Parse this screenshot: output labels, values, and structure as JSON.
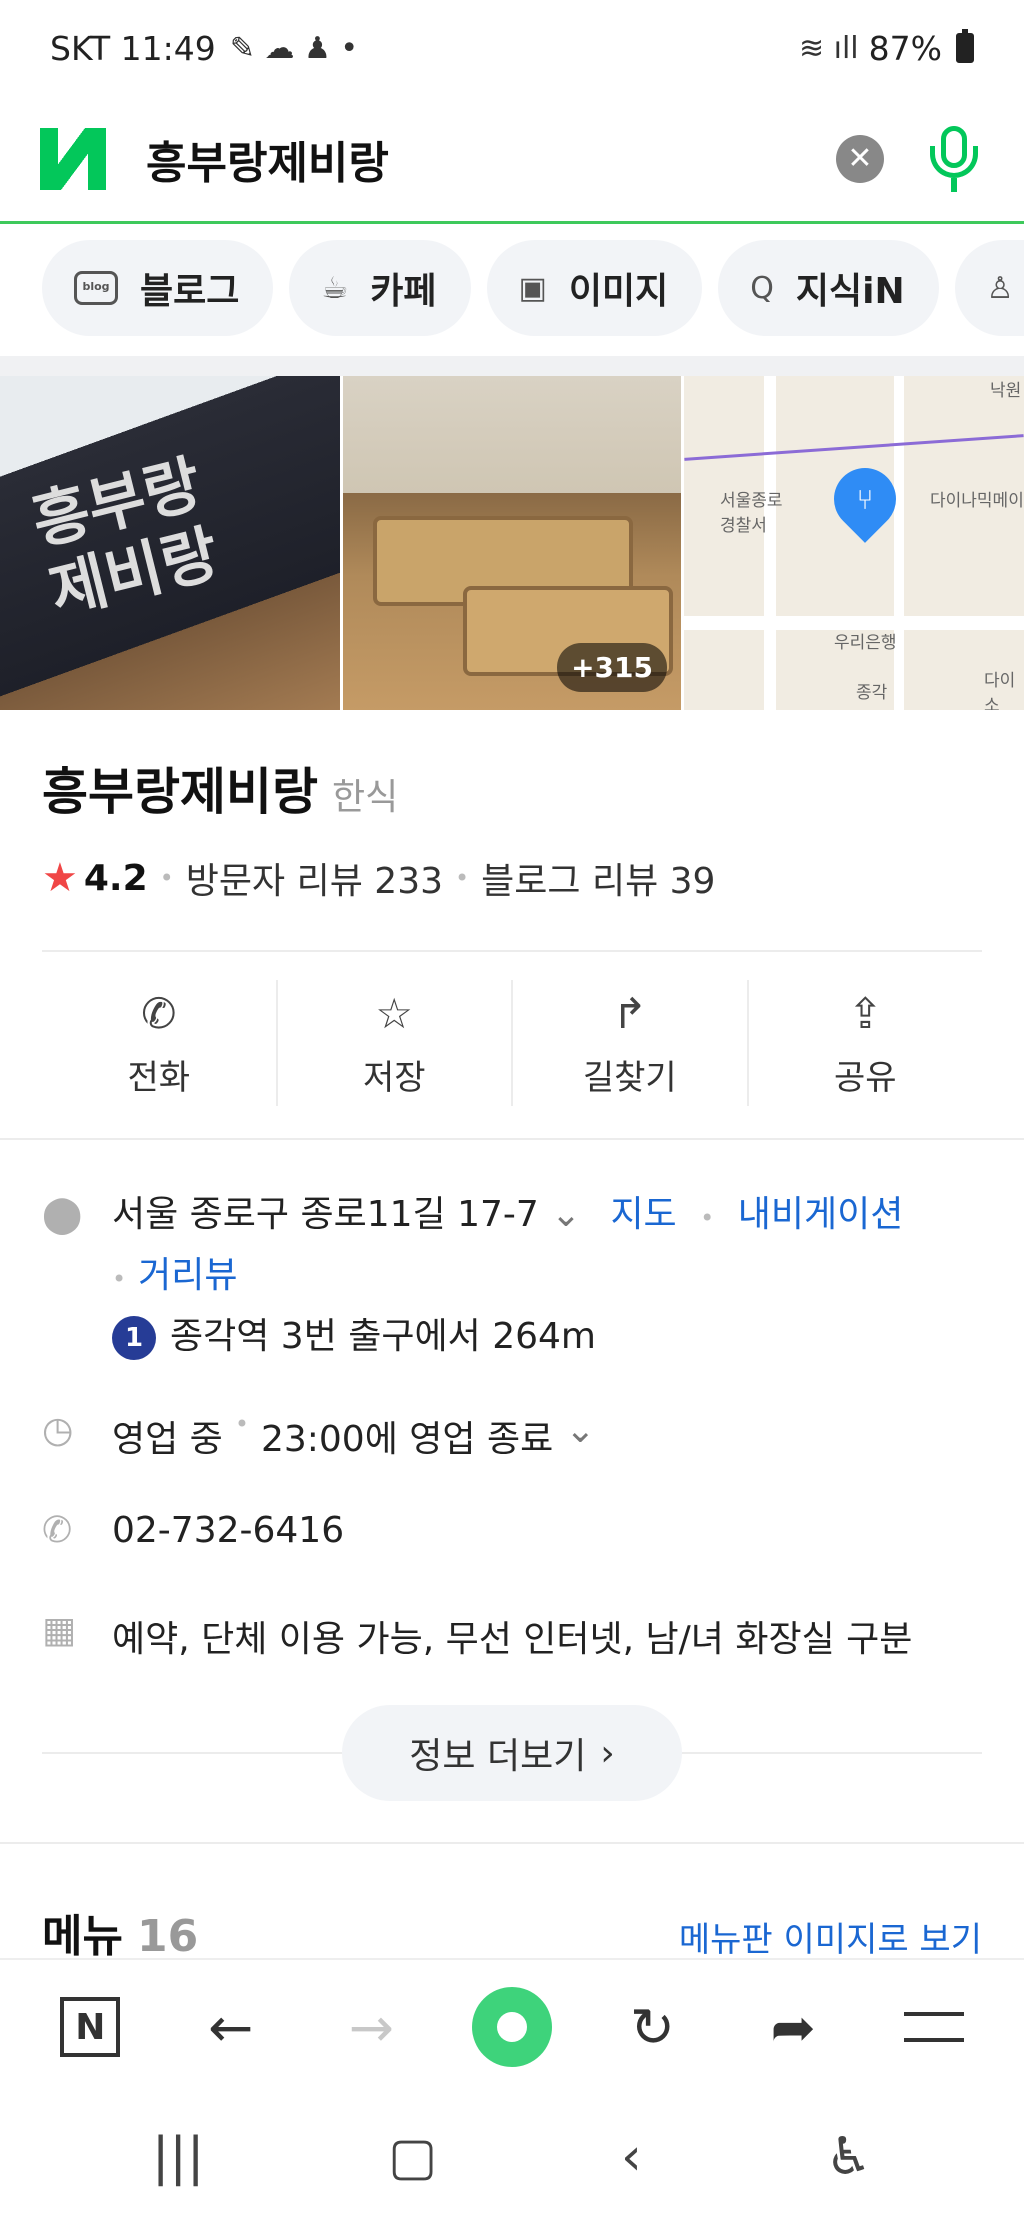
{
  "status_bar": {
    "carrier_time": "SKT 11:49",
    "battery": "87%"
  },
  "search": {
    "query": "흥부랑제비랑",
    "logo": "N"
  },
  "chips": [
    {
      "label": "블로그",
      "icon": "blog-icon",
      "icon_text": "blog"
    },
    {
      "label": "카페",
      "icon": "cafe-cup-icon"
    },
    {
      "label": "이미지",
      "icon": "image-icon"
    },
    {
      "label": "지식iN",
      "icon": "knowledge-search-icon"
    }
  ],
  "gallery": {
    "sign_text": "흥부랑\n제비랑",
    "photo_count": "+315",
    "map_labels": [
      "서울종로\n경찰서",
      "다이나믹메이",
      "우리은행",
      "종각",
      "다이소",
      "낙원"
    ]
  },
  "place": {
    "name": "흥부랑제비랑",
    "category": "한식",
    "rating": "4.2",
    "visitor_reviews": "방문자 리뷰 233",
    "blog_reviews": "블로그 리뷰 39"
  },
  "actions": [
    {
      "label": "전화",
      "icon": "phone-icon"
    },
    {
      "label": "저장",
      "icon": "star-icon"
    },
    {
      "label": "길찾기",
      "icon": "directions-icon"
    },
    {
      "label": "공유",
      "icon": "share-icon"
    }
  ],
  "details": {
    "address": "서울 종로구 종로11길 17-7",
    "map_link": "지도",
    "navigation_link": "내비게이션",
    "street_view_link": "거리뷰",
    "subway_line": "1",
    "subway_text": "종각역 3번 출구에서 264m",
    "hours_status": "영업 중",
    "hours_text": "23:00에 영업 종료",
    "phone": "02-732-6416",
    "amenities": "예약, 단체 이용 가능, 무선 인터넷, 남/녀 화장실 구분",
    "more_button": "정보 더보기"
  },
  "menu": {
    "title": "메뉴",
    "count": "16",
    "board_link": "메뉴판 이미지로 보기"
  },
  "colors": {
    "naver_green": "#03c75a",
    "link_blue": "#1a67d2",
    "star_red": "#f04646",
    "subway_line1": "#263c96"
  }
}
